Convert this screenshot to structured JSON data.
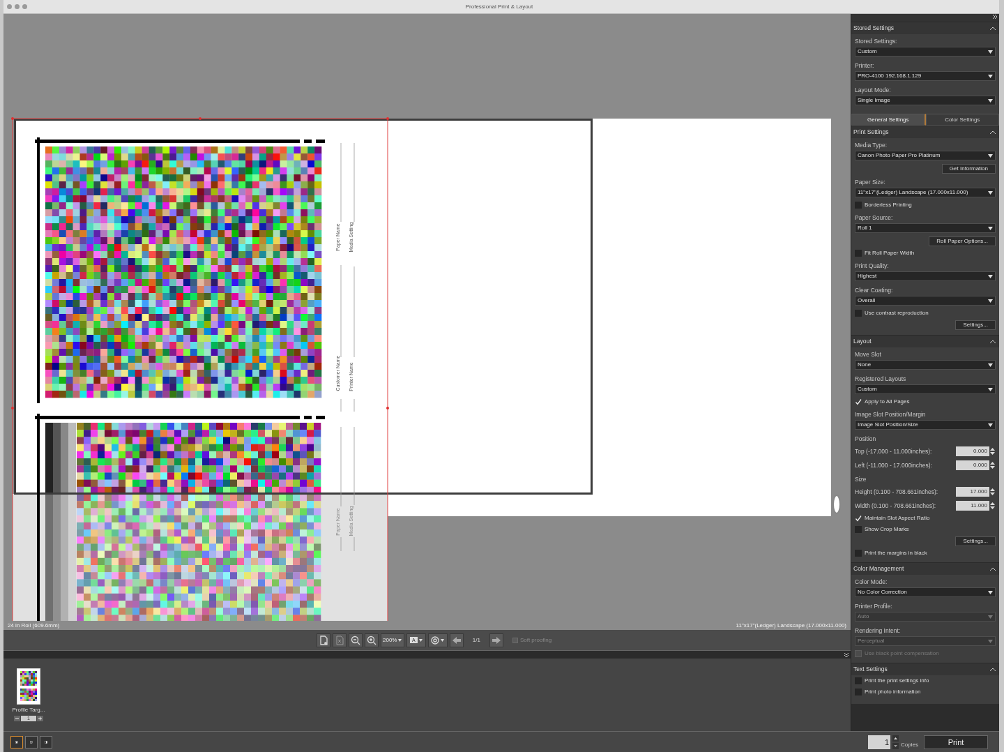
{
  "window": {
    "title": "Professional Print & Layout"
  },
  "preview": {
    "form_labels": [
      {
        "text": "Paper Name"
      },
      {
        "text": "Media Setting"
      },
      {
        "text": "Customer Name"
      },
      {
        "text": "Printer Name"
      },
      {
        "text": "Paper Name"
      },
      {
        "text": "Media Setting"
      }
    ],
    "roll_info": "24 in Roll (609.6mm)",
    "paper_info": "11\"x17\"(Ledger) Landscape (17.000x11.000)"
  },
  "toolbar": {
    "zoom": "200%",
    "text_mode": "A",
    "page": "1/1",
    "soft_proofing": {
      "label": "Soft proofing",
      "checked": false,
      "disabled": true
    }
  },
  "thumbnails": [
    {
      "label": "Profile Targ...",
      "count": "1",
      "selected": true
    }
  ],
  "view_buttons": [
    {
      "selected": true
    },
    {
      "selected": false
    },
    {
      "selected": false
    }
  ],
  "sidebar": {
    "sections": [
      {
        "title": "Stored Settings",
        "expanded": true,
        "items": [
          {
            "kind": "label",
            "text": "Stored Settings:"
          },
          {
            "kind": "select",
            "text": "Custom"
          },
          {
            "kind": "label",
            "text": "Printer:"
          },
          {
            "kind": "select",
            "text": "PRO-4100 192.168.1.129"
          },
          {
            "kind": "label",
            "text": "Layout Mode:"
          },
          {
            "kind": "select",
            "text": "Single Image"
          }
        ]
      },
      {
        "title": "Print Settings",
        "expanded": true,
        "items": [
          {
            "kind": "label",
            "text": "Media Type:"
          },
          {
            "kind": "select",
            "text": "Canon Photo Paper Pro Platinum"
          },
          {
            "kind": "button",
            "text": "Get Information"
          },
          {
            "kind": "label",
            "text": "Paper Size:"
          },
          {
            "kind": "select",
            "text": "11\"x17\"(Ledger) Landscape (17.000x11.000)"
          },
          {
            "kind": "checkbox",
            "text": "Borderless Printing",
            "checked": false
          },
          {
            "kind": "label",
            "text": "Paper Source:"
          },
          {
            "kind": "select",
            "text": "Roll 1"
          },
          {
            "kind": "button",
            "text": "Roll Paper Options..."
          },
          {
            "kind": "checkbox",
            "text": "Fit Roll Paper Width",
            "checked": false
          },
          {
            "kind": "label",
            "text": "Print Quality:"
          },
          {
            "kind": "select",
            "text": "Highest"
          },
          {
            "kind": "label",
            "text": "Clear Coating:"
          },
          {
            "kind": "select",
            "text": "Overall"
          },
          {
            "kind": "checkbox",
            "text": "Use contrast reproduction",
            "checked": false
          },
          {
            "kind": "button",
            "text": "Settings..."
          }
        ]
      },
      {
        "title": "Layout",
        "expanded": true,
        "items": [
          {
            "kind": "label",
            "text": "Move Slot"
          },
          {
            "kind": "select",
            "text": "None"
          },
          {
            "kind": "label",
            "text": "Registered Layouts"
          },
          {
            "kind": "select",
            "text": "Custom"
          },
          {
            "kind": "checkbox",
            "text": "Apply to All Pages",
            "checked": true
          },
          {
            "kind": "label",
            "text": "Image Slot Position/Margin"
          },
          {
            "kind": "select",
            "text": "Image Slot Position/Size"
          },
          {
            "kind": "label",
            "text": "Position"
          },
          {
            "kind": "spin",
            "text": "Top (-17.000 - 11.000inches):",
            "value": "0.000"
          },
          {
            "kind": "spin",
            "text": "Left (-11.000 - 17.000inches):",
            "value": "0.000"
          },
          {
            "kind": "label",
            "text": "Size"
          },
          {
            "kind": "spin",
            "text": "Height (0.100 - 708.661inches):",
            "value": "17.000"
          },
          {
            "kind": "spin",
            "text": "Width (0.100 - 708.661inches):",
            "value": "11.000"
          },
          {
            "kind": "checkbox",
            "text": "Maintain Slot Aspect Ratio",
            "checked": true
          },
          {
            "kind": "checkbox",
            "text": "Show Crop Marks",
            "checked": false
          },
          {
            "kind": "button",
            "text": "Settings..."
          },
          {
            "kind": "checkbox",
            "text": "Print the margins in black",
            "checked": false
          }
        ]
      },
      {
        "title": "Color Management",
        "expanded": true,
        "items": [
          {
            "kind": "label",
            "text": "Color Mode:",
            "disabled": false
          },
          {
            "kind": "select",
            "text": "No Color Correction",
            "disabled": false
          },
          {
            "kind": "label",
            "text": "Printer Profile:",
            "disabled": false
          },
          {
            "kind": "select",
            "text": "Auto",
            "disabled": true
          },
          {
            "kind": "label",
            "text": "Rendering Intent:",
            "disabled": false
          },
          {
            "kind": "select",
            "text": "Perceptual",
            "disabled": true
          },
          {
            "kind": "checkbox",
            "text": "Use black point compensation",
            "checked": false,
            "disabled": true
          }
        ]
      },
      {
        "title": "Text Settings",
        "expanded": true,
        "items": [
          {
            "kind": "checkbox",
            "text": "Print the print settings info",
            "checked": false
          },
          {
            "kind": "checkbox",
            "text": "Print photo information",
            "checked": false
          }
        ]
      }
    ],
    "tabs": [
      {
        "label": "General Settings",
        "selected": true
      },
      {
        "label": "Color Settings",
        "selected": false
      }
    ]
  },
  "print_bar": {
    "copies": "1",
    "copies_label": "Copies",
    "print_button": "Print"
  }
}
